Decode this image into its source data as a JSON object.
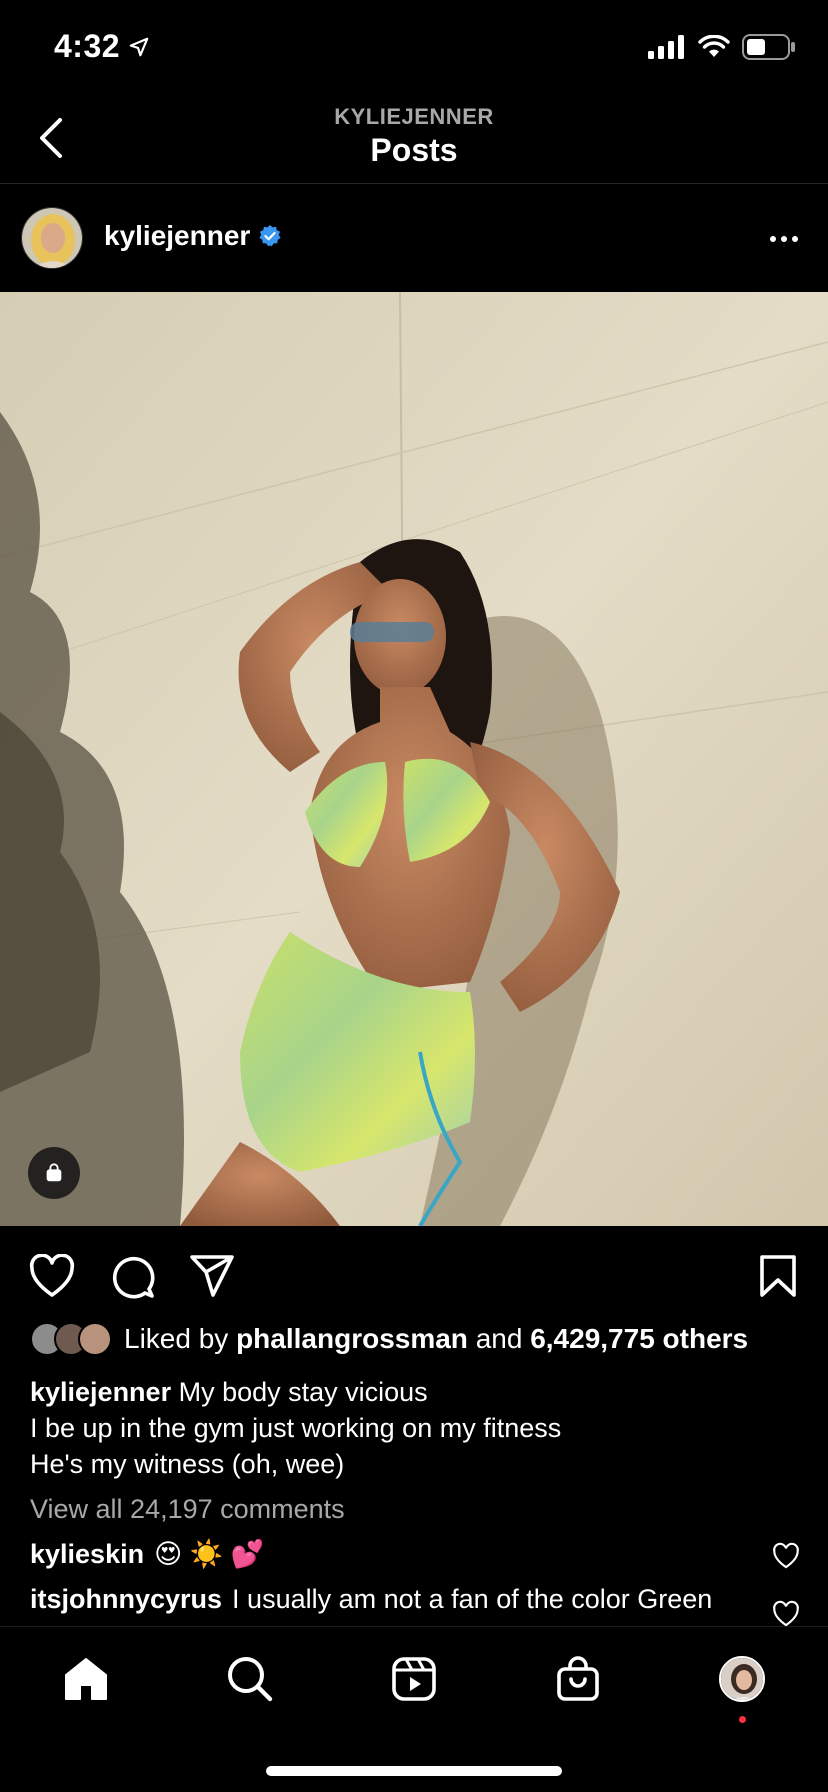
{
  "status_bar": {
    "time": "4:32"
  },
  "header": {
    "subtitle": "KYLIEJENNER",
    "title": "Posts"
  },
  "post": {
    "username": "kyliejenner",
    "verified": true,
    "likes": {
      "prefix": "Liked by",
      "liker": "phallangrossman",
      "conjunction": "and",
      "others": "6,429,775 others"
    },
    "caption": {
      "username": "kyliejenner",
      "line1": "My body stay vicious",
      "line2": "I be up in the gym just working on my fitness",
      "line3": "He's my witness (oh, wee)"
    },
    "view_comments": "View all 24,197 comments",
    "comments": [
      {
        "username": "kylieskin",
        "text": "😍 ☀️ 💕"
      },
      {
        "username": "itsjohnnycyrus",
        "text": "I usually am not a fan of the color Green"
      }
    ]
  },
  "colors": {
    "background": "#000000",
    "verified": "#3897f0",
    "muted": "#a8a8a8",
    "notification": "#ff3040"
  },
  "icons": {
    "status": [
      "location-arrow-icon",
      "signal-icon",
      "wifi-icon",
      "battery-icon"
    ],
    "actions": [
      "heart-icon",
      "comment-icon",
      "share-icon",
      "bookmark-icon"
    ],
    "tabs": [
      "home-icon",
      "search-icon",
      "reels-icon",
      "shop-icon",
      "profile-avatar"
    ]
  }
}
